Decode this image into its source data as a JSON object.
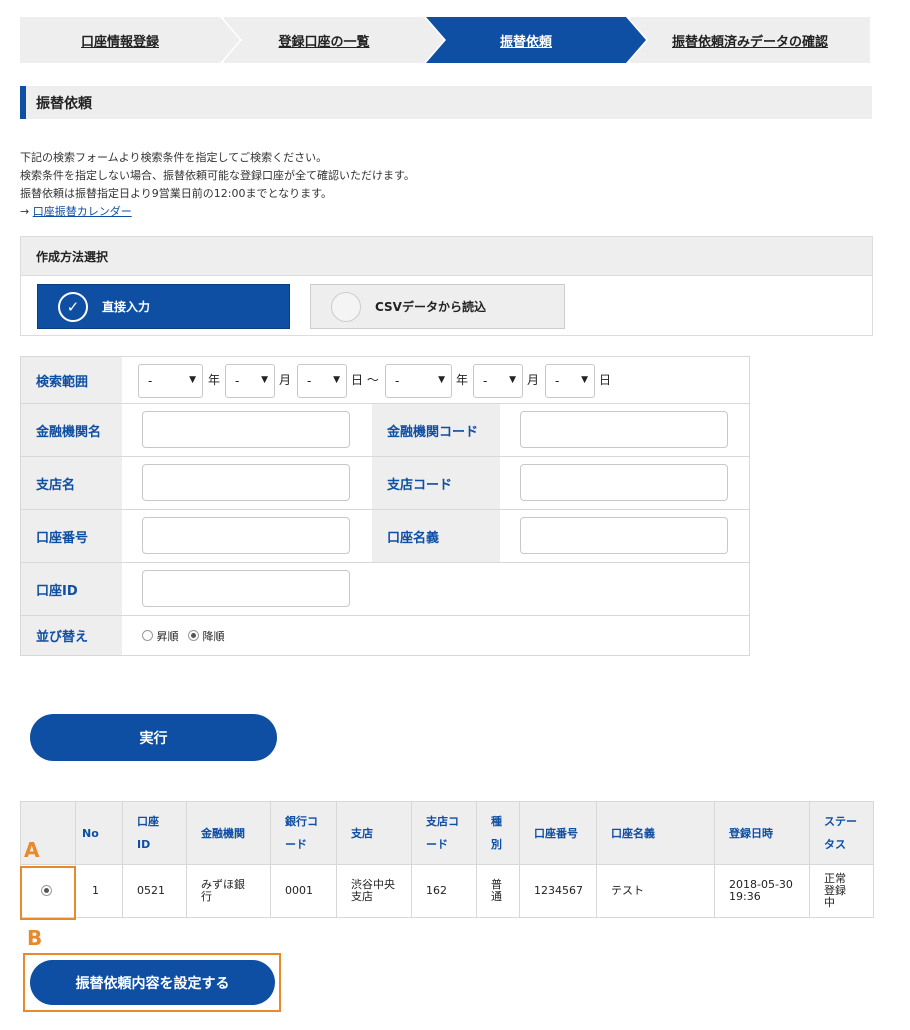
{
  "steps": [
    {
      "label": "口座情報登録"
    },
    {
      "label": "登録口座の一覧"
    },
    {
      "label": "振替依頼"
    },
    {
      "label": "振替依頼済みデータの確認"
    }
  ],
  "section_title": "振替依頼",
  "description": {
    "line1": "下記の検索フォームより検索条件を指定してご検索ください。",
    "line2": "検索条件を指定しない場合、振替依頼可能な登録口座が全て確認いただけます。",
    "line3": "振替依頼は振替指定日より9営業日前の12:00までとなります。",
    "arrow": "→",
    "calendar_link": "口座振替カレンダー"
  },
  "method": {
    "title": "作成方法選択",
    "direct_label": "直接入力",
    "direct_check": "✓",
    "csv_label": "CSVデータから読込"
  },
  "search": {
    "range_label": "検索範囲",
    "dash": "-",
    "arrow_icon": "▼",
    "year": "年",
    "month": "月",
    "day_tilde": "日 ～",
    "day": "日",
    "bank_name_label": "金融機関名",
    "bank_code_label": "金融機関コード",
    "branch_name_label": "支店名",
    "branch_code_label": "支店コード",
    "account_no_label": "口座番号",
    "account_holder_label": "口座名義",
    "account_id_label": "口座ID",
    "sort_label": "並び替え",
    "asc_label": "昇順",
    "desc_label": "降順"
  },
  "exec_label": "実行",
  "table": {
    "headers": {
      "no": "No",
      "account_id_1": "口座",
      "account_id_2": "ID",
      "bank": "金融機関",
      "bank_code_1": "銀行コ",
      "bank_code_2": "ード",
      "branch": "支店",
      "branch_code_1": "支店コ",
      "branch_code_2": "ード",
      "type_1": "種",
      "type_2": "別",
      "account_no": "口座番号",
      "holder": "口座名義",
      "registered": "登録日時",
      "status_1": "ステー",
      "status_2": "タス"
    },
    "row": {
      "no": "1",
      "account_id": "0521",
      "bank_1": "みずほ銀",
      "bank_2": "行",
      "bank_code": "0001",
      "branch_1": "渋谷中央",
      "branch_2": "支店",
      "branch_code": "162",
      "type_1": "普",
      "type_2": "通",
      "account_no": "1234567",
      "holder": "テスト",
      "date": "2018-05-30",
      "time": "19:36",
      "status_1": "正常",
      "status_2": "登録",
      "status_3": "中"
    }
  },
  "marker_a": "A",
  "marker_b": "B",
  "submit_label": "振替依頼内容を設定する",
  "colors": {
    "accent": "#0e4ea3",
    "highlight": "#e8892b",
    "panel": "#eeeeee"
  }
}
